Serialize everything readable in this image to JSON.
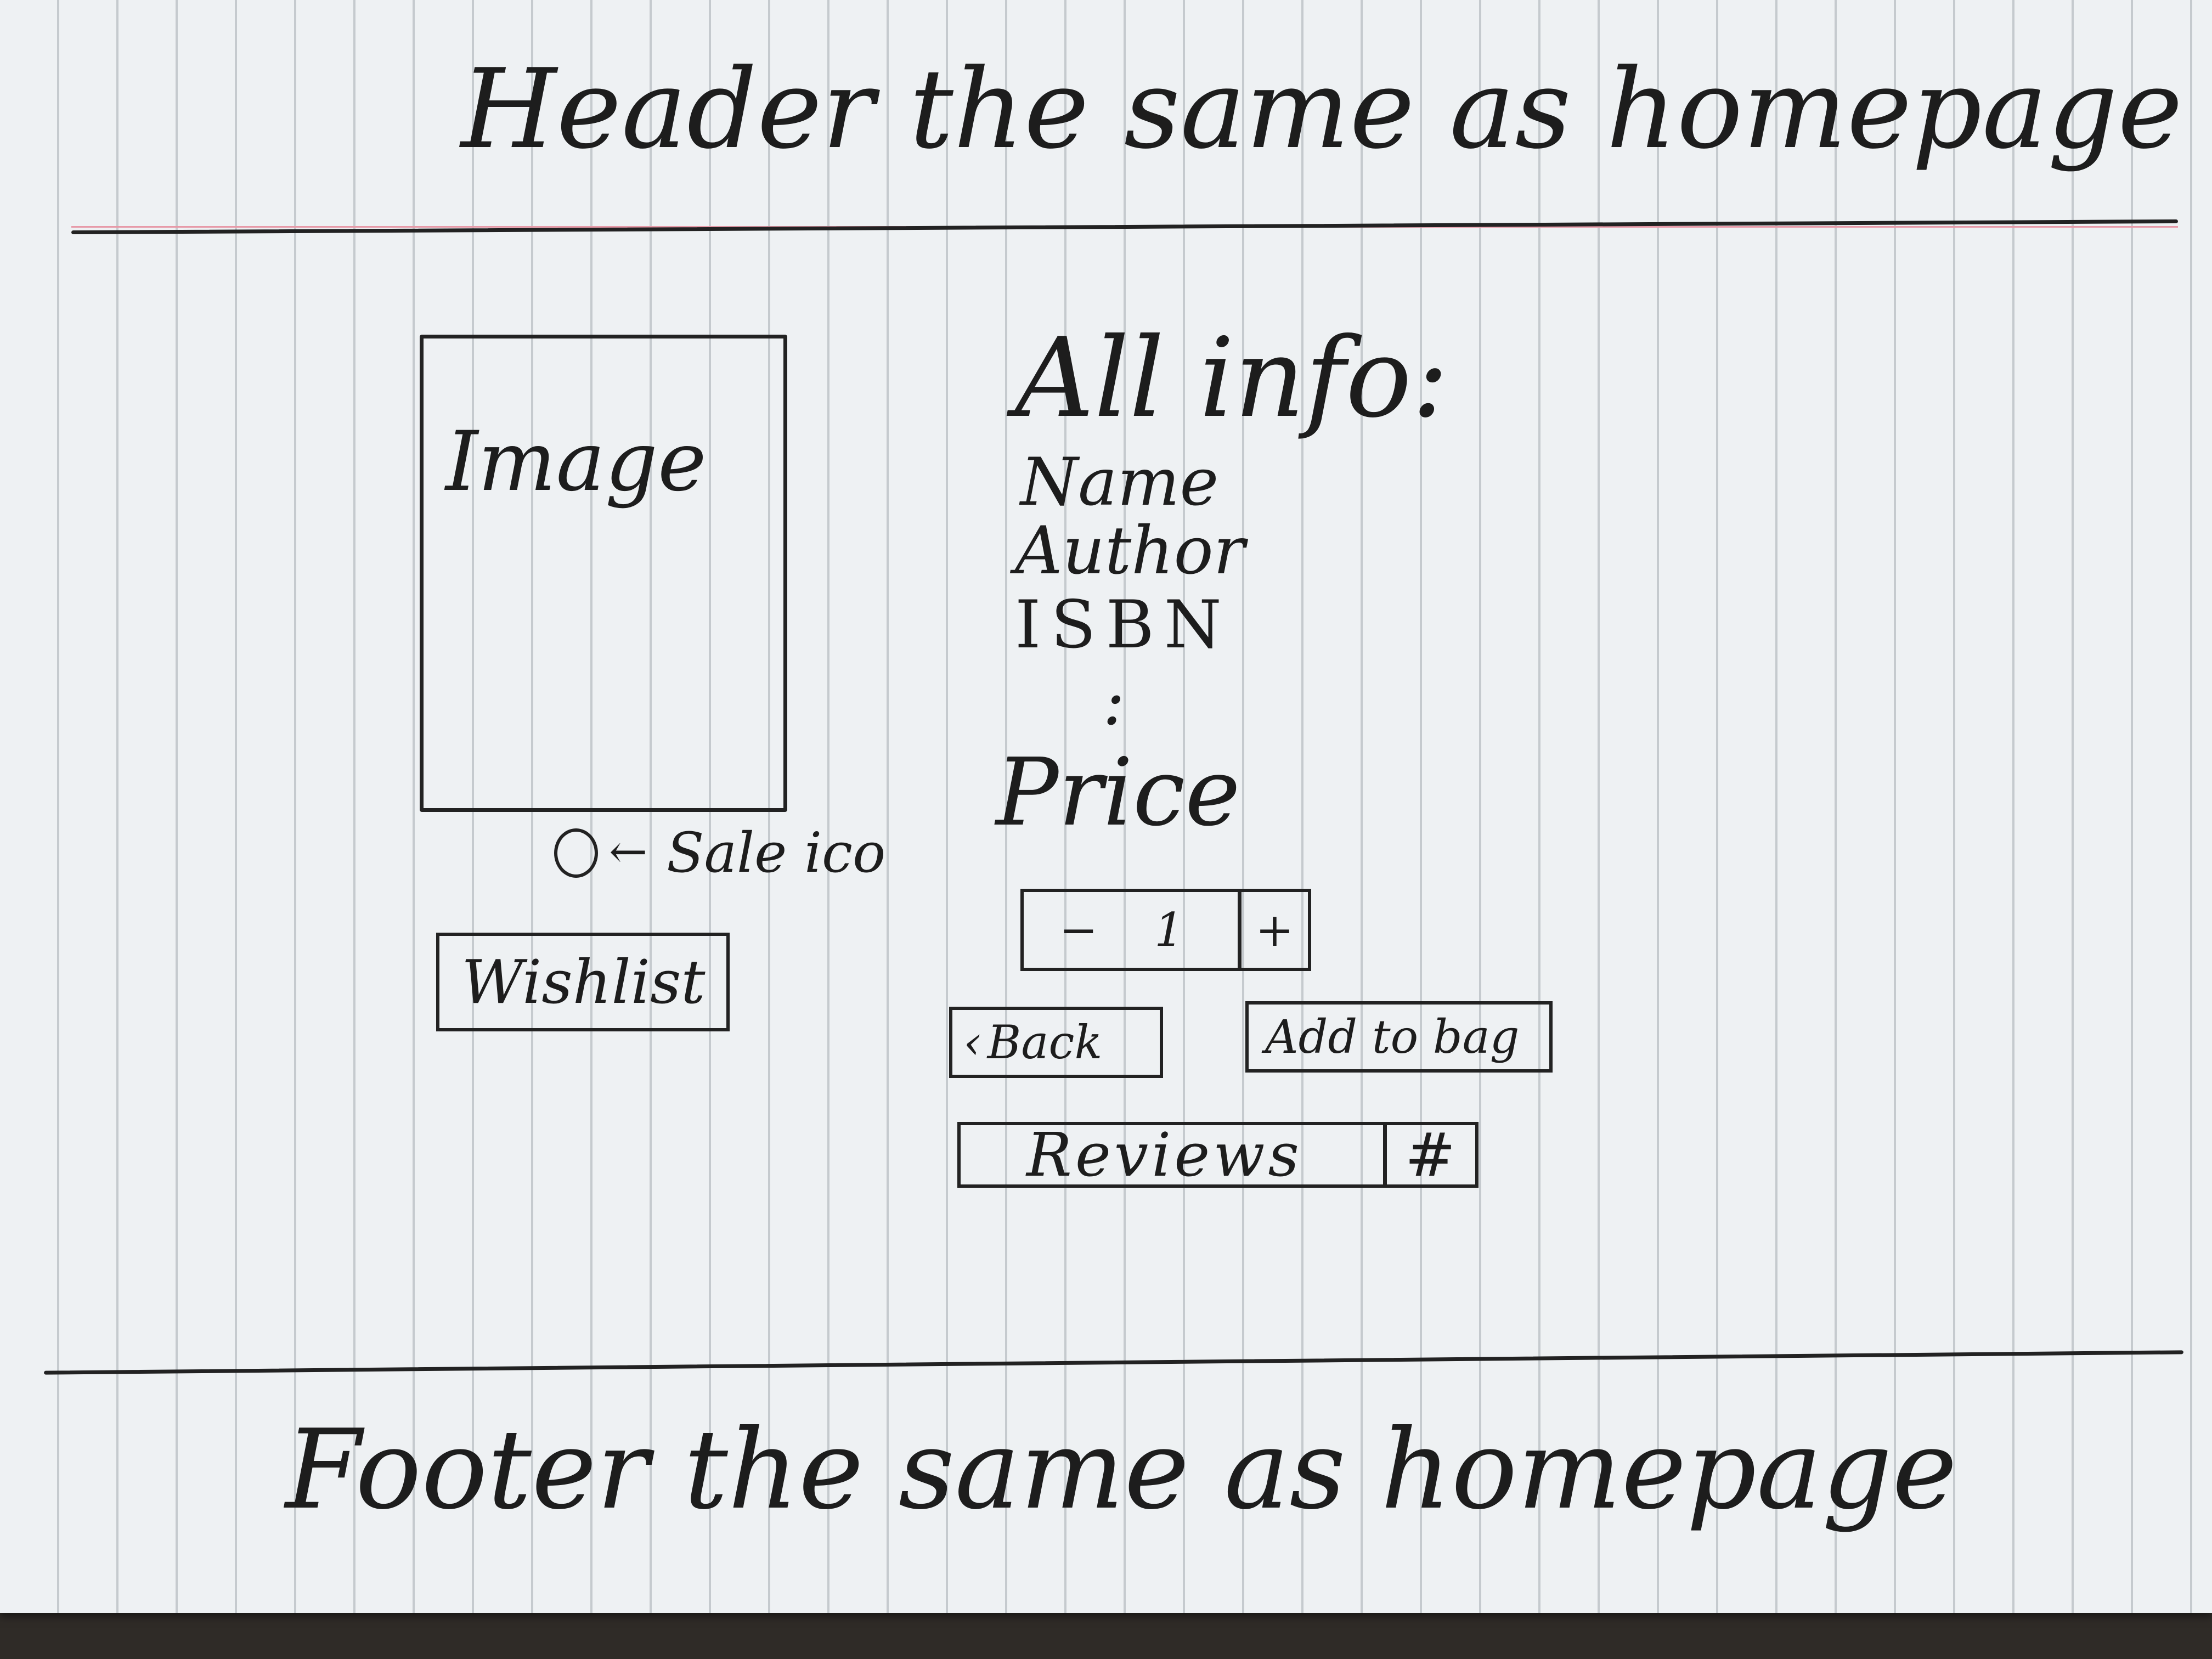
{
  "header": {
    "text": "Header the same as homepage"
  },
  "product": {
    "image_label": "Image",
    "sale_icon_label": "Sale ico",
    "wishlist_label": "Wishlist",
    "info_title": "All info:",
    "fields": [
      "Name",
      "Author",
      "ISBN"
    ],
    "ellipsis": ":",
    "price_label": "Price",
    "quantity": {
      "minus": "−",
      "value": "1",
      "plus": "+"
    },
    "back_label": "Back",
    "add_to_bag_label": "Add to bag",
    "reviews_label": "Reviews",
    "reviews_count_label": "#"
  },
  "footer": {
    "text": "Footer the same as homepage"
  },
  "icons": {
    "back": "chevron-left-icon",
    "sale": "sale-circle-icon",
    "arrow": "arrow-left-icon"
  }
}
